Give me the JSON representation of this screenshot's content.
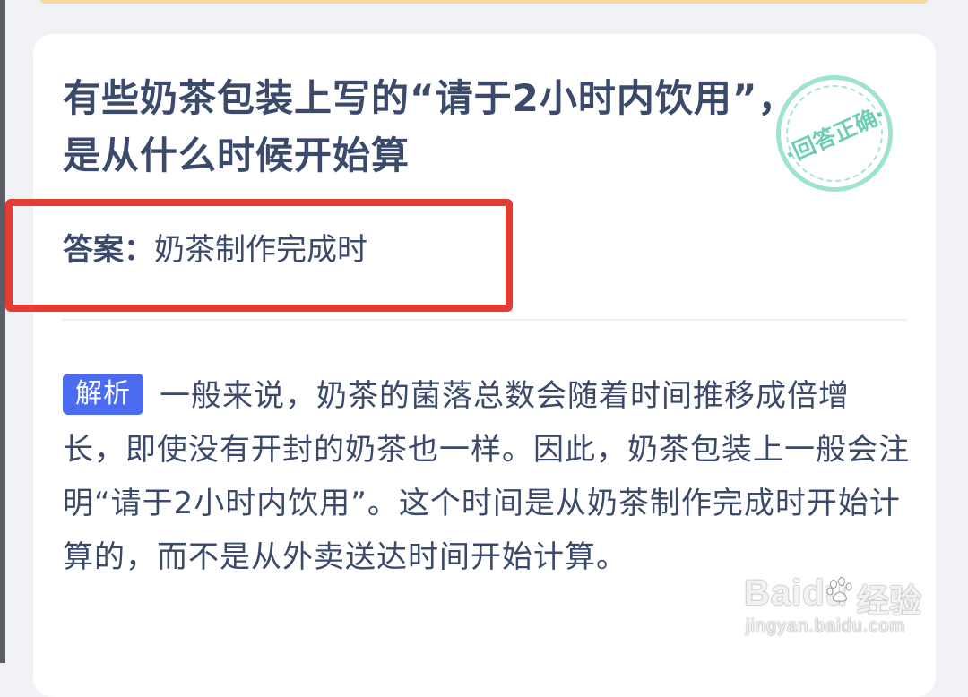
{
  "question": {
    "line1": "有些奶茶包装上写的“请于2小时内饮用”，",
    "line2": "是从什么时候开始算"
  },
  "stamp": {
    "text": "·回答正确·",
    "color": "#4ecca9"
  },
  "answer": {
    "label": "答案：",
    "value": "奶茶制作完成时"
  },
  "explanation": {
    "badge": "解析",
    "text": "一般来说，奶茶的菌落总数会随着时间推移成倍增长，即使没有开封的奶茶也一样。因此，奶茶包装上一般会注明“请于2小时内饮用”。这个时间是从奶茶制作完成时开始计算的，而不是从外卖送达时间开始计算。"
  },
  "watermark": {
    "logo": "Bai",
    "logo_suffix": "du",
    "cn": "经验",
    "url": "jingyan.baidu.com"
  },
  "colors": {
    "text": "#3b4a6b",
    "highlight": "#e53c32",
    "badge": "#4c6cf0"
  }
}
